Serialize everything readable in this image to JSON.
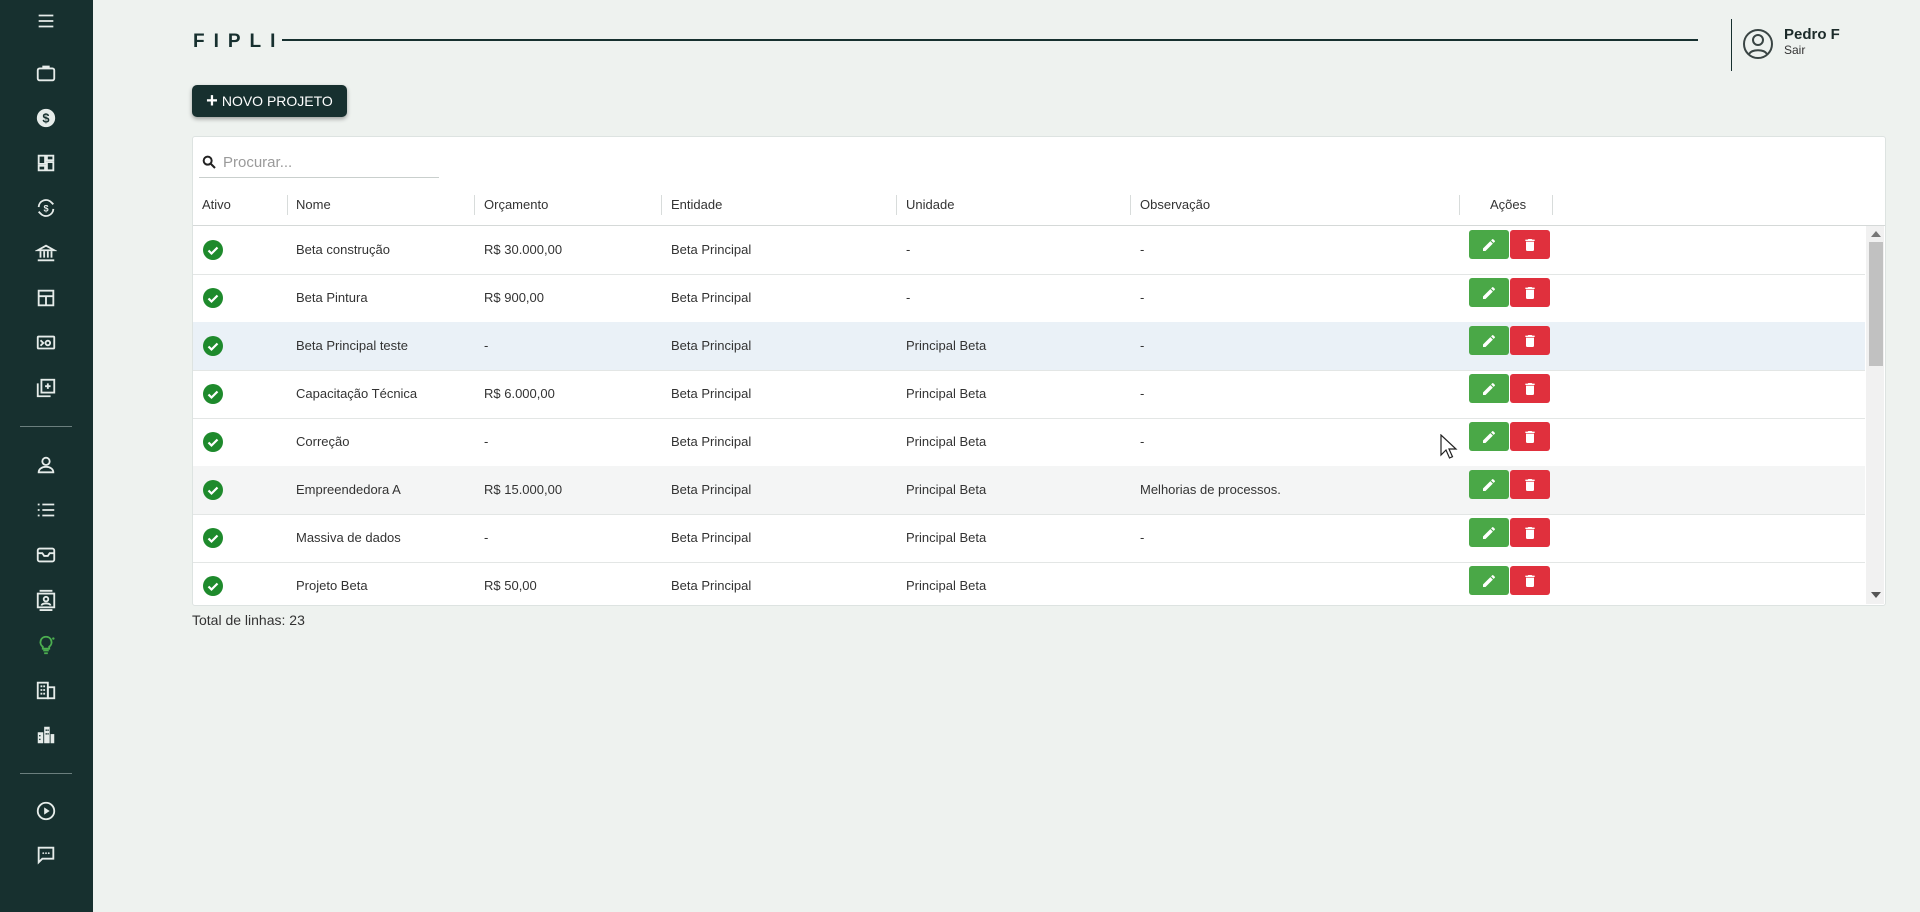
{
  "header": {
    "brand": "FIPLI",
    "user_name": "Pedro F",
    "logout_label": "Sair"
  },
  "toolbar": {
    "new_project_label": "NOVO PROJETO"
  },
  "search": {
    "placeholder": "Procurar..."
  },
  "table": {
    "columns": [
      "Ativo",
      "Nome",
      "Orçamento",
      "Entidade",
      "Unidade",
      "Observação",
      "Ações"
    ],
    "rows": [
      {
        "nome": "Beta construção",
        "orcamento": "R$ 30.000,00",
        "entidade": "Beta Principal",
        "unidade": "-",
        "observacao": "-"
      },
      {
        "nome": "Beta Pintura",
        "orcamento": "R$ 900,00",
        "entidade": "Beta Principal",
        "unidade": "-",
        "observacao": "-"
      },
      {
        "nome": "Beta Principal teste",
        "orcamento": "-",
        "entidade": "Beta Principal",
        "unidade": "Principal Beta",
        "observacao": "-"
      },
      {
        "nome": "Capacitação Técnica",
        "orcamento": "R$ 6.000,00",
        "entidade": "Beta Principal",
        "unidade": "Principal Beta",
        "observacao": "-"
      },
      {
        "nome": "Correção",
        "orcamento": "-",
        "entidade": "Beta Principal",
        "unidade": "Principal Beta",
        "observacao": "-"
      },
      {
        "nome": "Empreendedora A",
        "orcamento": "R$ 15.000,00",
        "entidade": "Beta Principal",
        "unidade": "Principal Beta",
        "observacao": "Melhorias de processos."
      },
      {
        "nome": "Massiva de dados",
        "orcamento": "-",
        "entidade": "Beta Principal",
        "unidade": "Principal Beta",
        "observacao": "-"
      },
      {
        "nome": "Projeto Beta",
        "orcamento": "R$ 50,00",
        "entidade": "Beta Principal",
        "unidade": "Principal Beta",
        "observacao": ""
      }
    ]
  },
  "footer": {
    "total_label": "Total de linhas: 23"
  },
  "sidebar": {
    "icons": [
      "menu-icon",
      "briefcase-icon",
      "dollar-icon",
      "dashboard-icon",
      "currency-exchange-icon",
      "bank-icon",
      "layout-icon",
      "screen-settings-icon",
      "add-copy-icon",
      "person-icon",
      "list-icon",
      "inbox-icon",
      "contact-card-icon",
      "lightbulb-icon",
      "building-icon",
      "city-icon",
      "play-circle-icon",
      "chat-icon"
    ],
    "active": "lightbulb-icon"
  },
  "colors": {
    "sidebar": "#17302f",
    "accent_active": "#4caf50",
    "edit": "#4aa847",
    "delete": "#e0303d",
    "check": "#1e8a2c"
  }
}
